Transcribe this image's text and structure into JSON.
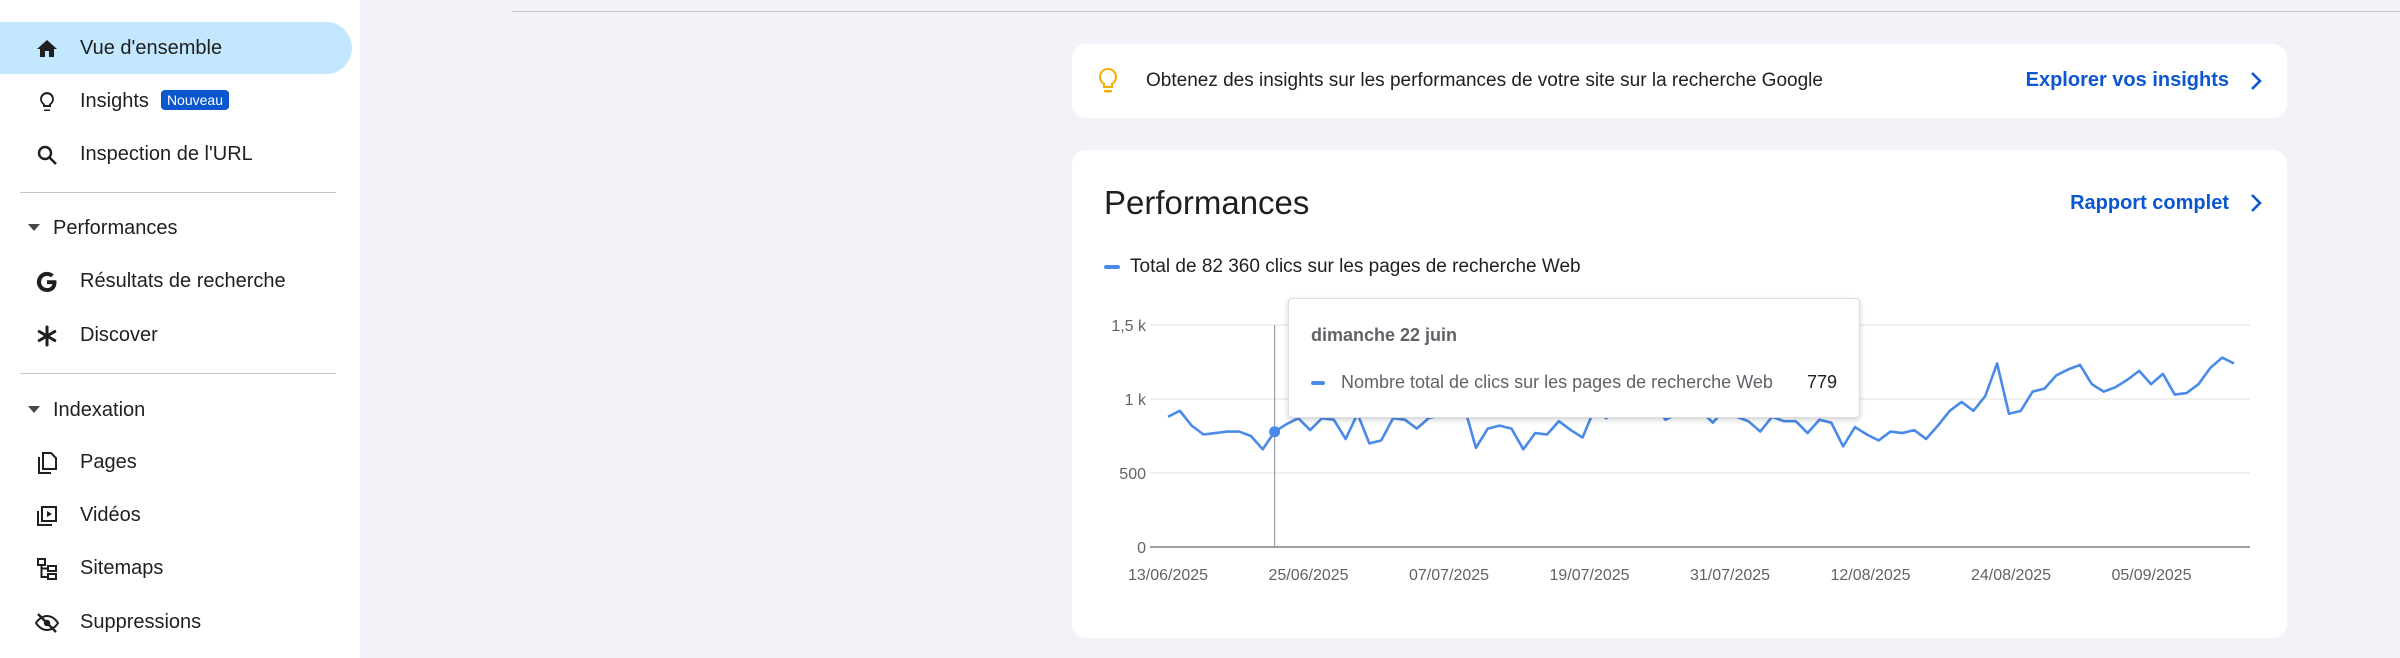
{
  "sidebar": {
    "items": [
      {
        "label": "Vue d'ensemble",
        "icon": "home-icon",
        "active": true
      },
      {
        "label": "Insights",
        "icon": "lightbulb-icon",
        "badge": "Nouveau"
      },
      {
        "label": "Inspection de l'URL",
        "icon": "search-icon"
      }
    ],
    "sections": [
      {
        "label": "Performances",
        "items": [
          {
            "label": "Résultats de recherche",
            "icon": "google-g-icon"
          },
          {
            "label": "Discover",
            "icon": "asterisk-icon"
          }
        ]
      },
      {
        "label": "Indexation",
        "items": [
          {
            "label": "Pages",
            "icon": "pages-icon"
          },
          {
            "label": "Vidéos",
            "icon": "video-icon"
          },
          {
            "label": "Sitemaps",
            "icon": "sitemap-icon"
          },
          {
            "label": "Suppressions",
            "icon": "eye-off-icon"
          }
        ]
      }
    ]
  },
  "banner": {
    "text": "Obtenez des insights sur les performances de votre site sur la recherche Google",
    "link": "Explorer vos insights",
    "icon": "lightbulb-icon"
  },
  "performance": {
    "title": "Performances",
    "link": "Rapport complet",
    "legend": "Total de 82 360 clics sur les pages de recherche Web"
  },
  "tooltip": {
    "date": "dimanche 22 juin",
    "metric": "Nombre total de clics sur les pages de recherche Web",
    "value": "779"
  },
  "colors": {
    "accent": "#0b57d0",
    "series": "#4a8ae8",
    "active_bg": "#c2e7ff",
    "bulb": "#f9ab00"
  },
  "chart_data": {
    "type": "line",
    "y_tick_labels": [
      "0",
      "500",
      "1 k",
      "1,5 k"
    ],
    "ylim": [
      0,
      1500
    ],
    "x_tick_labels": [
      "13/06/2025",
      "25/06/2025",
      "07/07/2025",
      "19/07/2025",
      "31/07/2025",
      "12/08/2025",
      "24/08/2025",
      "05/09/2025"
    ],
    "grid": true,
    "series": [
      {
        "name": "Nombre total de clics sur les pages de recherche Web",
        "values": [
          880,
          920,
          820,
          760,
          770,
          780,
          780,
          750,
          660,
          779,
          830,
          870,
          790,
          870,
          860,
          730,
          900,
          700,
          720,
          870,
          860,
          800,
          870,
          890,
          1000,
          950,
          670,
          800,
          820,
          800,
          660,
          770,
          760,
          850,
          790,
          740,
          930,
          870,
          960,
          900,
          920,
          960,
          860,
          900,
          950,
          920,
          840,
          930,
          880,
          850,
          780,
          880,
          850,
          850,
          770,
          860,
          840,
          680,
          810,
          760,
          720,
          780,
          770,
          790,
          730,
          820,
          920,
          980,
          920,
          1020,
          1240,
          900,
          920,
          1050,
          1070,
          1160,
          1200,
          1230,
          1100,
          1050,
          1080,
          1130,
          1190,
          1100,
          1170,
          1030,
          1040,
          1100,
          1210,
          1280,
          1240
        ]
      }
    ]
  }
}
